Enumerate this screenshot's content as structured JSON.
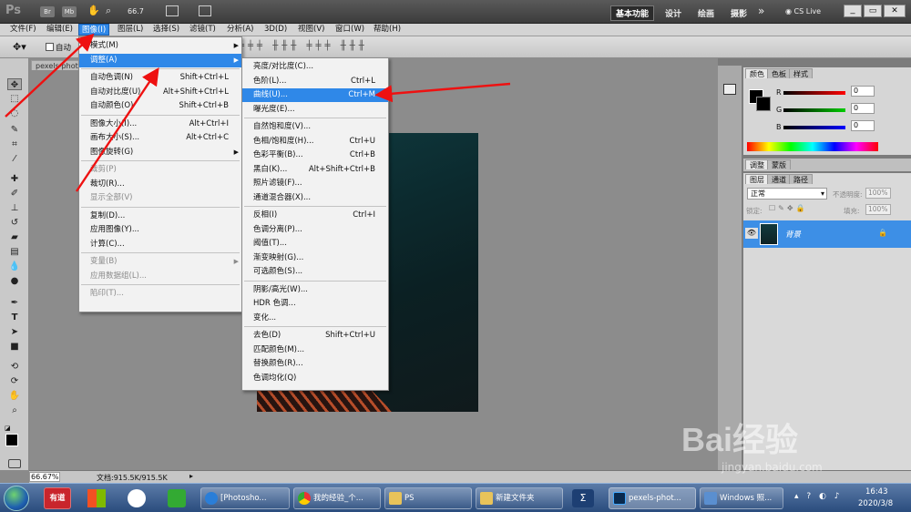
{
  "app": {
    "logo": "Ps",
    "logo_br": "Br",
    "logo_mb": "Mb",
    "zoom": "66.7",
    "workspaces": [
      "基本功能",
      "设计",
      "绘画",
      "摄影"
    ],
    "more": "»",
    "cslive": "CS Live"
  },
  "menubar": {
    "items": [
      "文件(F)",
      "编辑(E)",
      "图像(I)",
      "图层(L)",
      "选择(S)",
      "滤镜(T)",
      "分析(A)",
      "3D(D)",
      "视图(V)",
      "窗口(W)",
      "帮助(H)"
    ]
  },
  "options": {
    "auto_select": "自动"
  },
  "doc_tab": {
    "label": "pexels-phot"
  },
  "image_menu": {
    "items": [
      {
        "label": "模式(M)",
        "shortcut": "",
        "sub": true,
        "disabled": false
      },
      {
        "label": "调整(A)",
        "shortcut": "",
        "sub": true,
        "disabled": false,
        "highlight": true
      },
      {
        "label": "自动色调(N)",
        "shortcut": "Shift+Ctrl+L",
        "disabled": false
      },
      {
        "label": "自动对比度(U)",
        "shortcut": "Alt+Shift+Ctrl+L",
        "disabled": false
      },
      {
        "label": "自动颜色(O)",
        "shortcut": "Shift+Ctrl+B",
        "disabled": false
      },
      {
        "label": "图像大小(I)...",
        "shortcut": "Alt+Ctrl+I",
        "disabled": false
      },
      {
        "label": "画布大小(S)...",
        "shortcut": "Alt+Ctrl+C",
        "disabled": false
      },
      {
        "label": "图像旋转(G)",
        "shortcut": "",
        "sub": true,
        "disabled": false
      },
      {
        "label": "裁剪(P)",
        "shortcut": "",
        "disabled": true
      },
      {
        "label": "裁切(R)...",
        "shortcut": "",
        "disabled": false
      },
      {
        "label": "显示全部(V)",
        "shortcut": "",
        "disabled": true
      },
      {
        "label": "复制(D)...",
        "shortcut": "",
        "disabled": false
      },
      {
        "label": "应用图像(Y)...",
        "shortcut": "",
        "disabled": false
      },
      {
        "label": "计算(C)...",
        "shortcut": "",
        "disabled": false
      },
      {
        "label": "变量(B)",
        "shortcut": "",
        "sub": true,
        "disabled": true
      },
      {
        "label": "应用数据组(L)...",
        "shortcut": "",
        "disabled": true
      },
      {
        "label": "陷印(T)...",
        "shortcut": "",
        "disabled": true
      }
    ]
  },
  "adjust_menu": {
    "items": [
      {
        "label": "亮度/对比度(C)...",
        "shortcut": ""
      },
      {
        "label": "色阶(L)...",
        "shortcut": "Ctrl+L"
      },
      {
        "label": "曲线(U)...",
        "shortcut": "Ctrl+M",
        "highlight": true
      },
      {
        "label": "曝光度(E)...",
        "shortcut": ""
      },
      {
        "label": "自然饱和度(V)...",
        "shortcut": ""
      },
      {
        "label": "色相/饱和度(H)...",
        "shortcut": "Ctrl+U"
      },
      {
        "label": "色彩平衡(B)...",
        "shortcut": "Ctrl+B"
      },
      {
        "label": "黑白(K)...",
        "shortcut": "Alt+Shift+Ctrl+B"
      },
      {
        "label": "照片滤镜(F)...",
        "shortcut": ""
      },
      {
        "label": "通道混合器(X)...",
        "shortcut": ""
      },
      {
        "label": "反相(I)",
        "shortcut": "Ctrl+I"
      },
      {
        "label": "色调分离(P)...",
        "shortcut": ""
      },
      {
        "label": "阈值(T)...",
        "shortcut": ""
      },
      {
        "label": "渐变映射(G)...",
        "shortcut": ""
      },
      {
        "label": "可选颜色(S)...",
        "shortcut": ""
      },
      {
        "label": "阴影/高光(W)...",
        "shortcut": ""
      },
      {
        "label": "HDR 色调...",
        "shortcut": ""
      },
      {
        "label": "变化...",
        "shortcut": ""
      },
      {
        "label": "去色(D)",
        "shortcut": "Shift+Ctrl+U"
      },
      {
        "label": "匹配颜色(M)...",
        "shortcut": ""
      },
      {
        "label": "替换颜色(R)...",
        "shortcut": ""
      },
      {
        "label": "色调均化(Q)",
        "shortcut": ""
      }
    ]
  },
  "color_panel": {
    "tabs": [
      "颜色",
      "色板",
      "样式"
    ],
    "channels": [
      {
        "name": "R",
        "value": "0"
      },
      {
        "name": "G",
        "value": "0"
      },
      {
        "name": "B",
        "value": "0"
      }
    ]
  },
  "adjust_panel": {
    "tabs": [
      "调整",
      "蒙版"
    ]
  },
  "layers_panel": {
    "tabs": [
      "图层",
      "通道",
      "路径"
    ],
    "blend_mode": "正常",
    "opacity_label": "不透明度:",
    "opacity": "100%",
    "lock_label": "锁定:",
    "fill_label": "填充:",
    "fill": "100%",
    "layer_name": "背景"
  },
  "status": {
    "zoom": "66.67%",
    "doc": "文档:915.5K/915.5K"
  },
  "taskbar": {
    "items": [
      "有道",
      "[Photosho...",
      "我的经验_个...",
      "PS",
      "新建文件夹",
      "pexels-phot...",
      "Windows 照..."
    ],
    "time": "16:43",
    "date": "2020/3/8"
  },
  "watermark": {
    "text": "Bai经验",
    "url": "jingyan.baidu.com"
  },
  "colors": {
    "highlight": "#2f88e8",
    "arrow": "#e11111",
    "layer_selected": "#3d8fe6"
  }
}
